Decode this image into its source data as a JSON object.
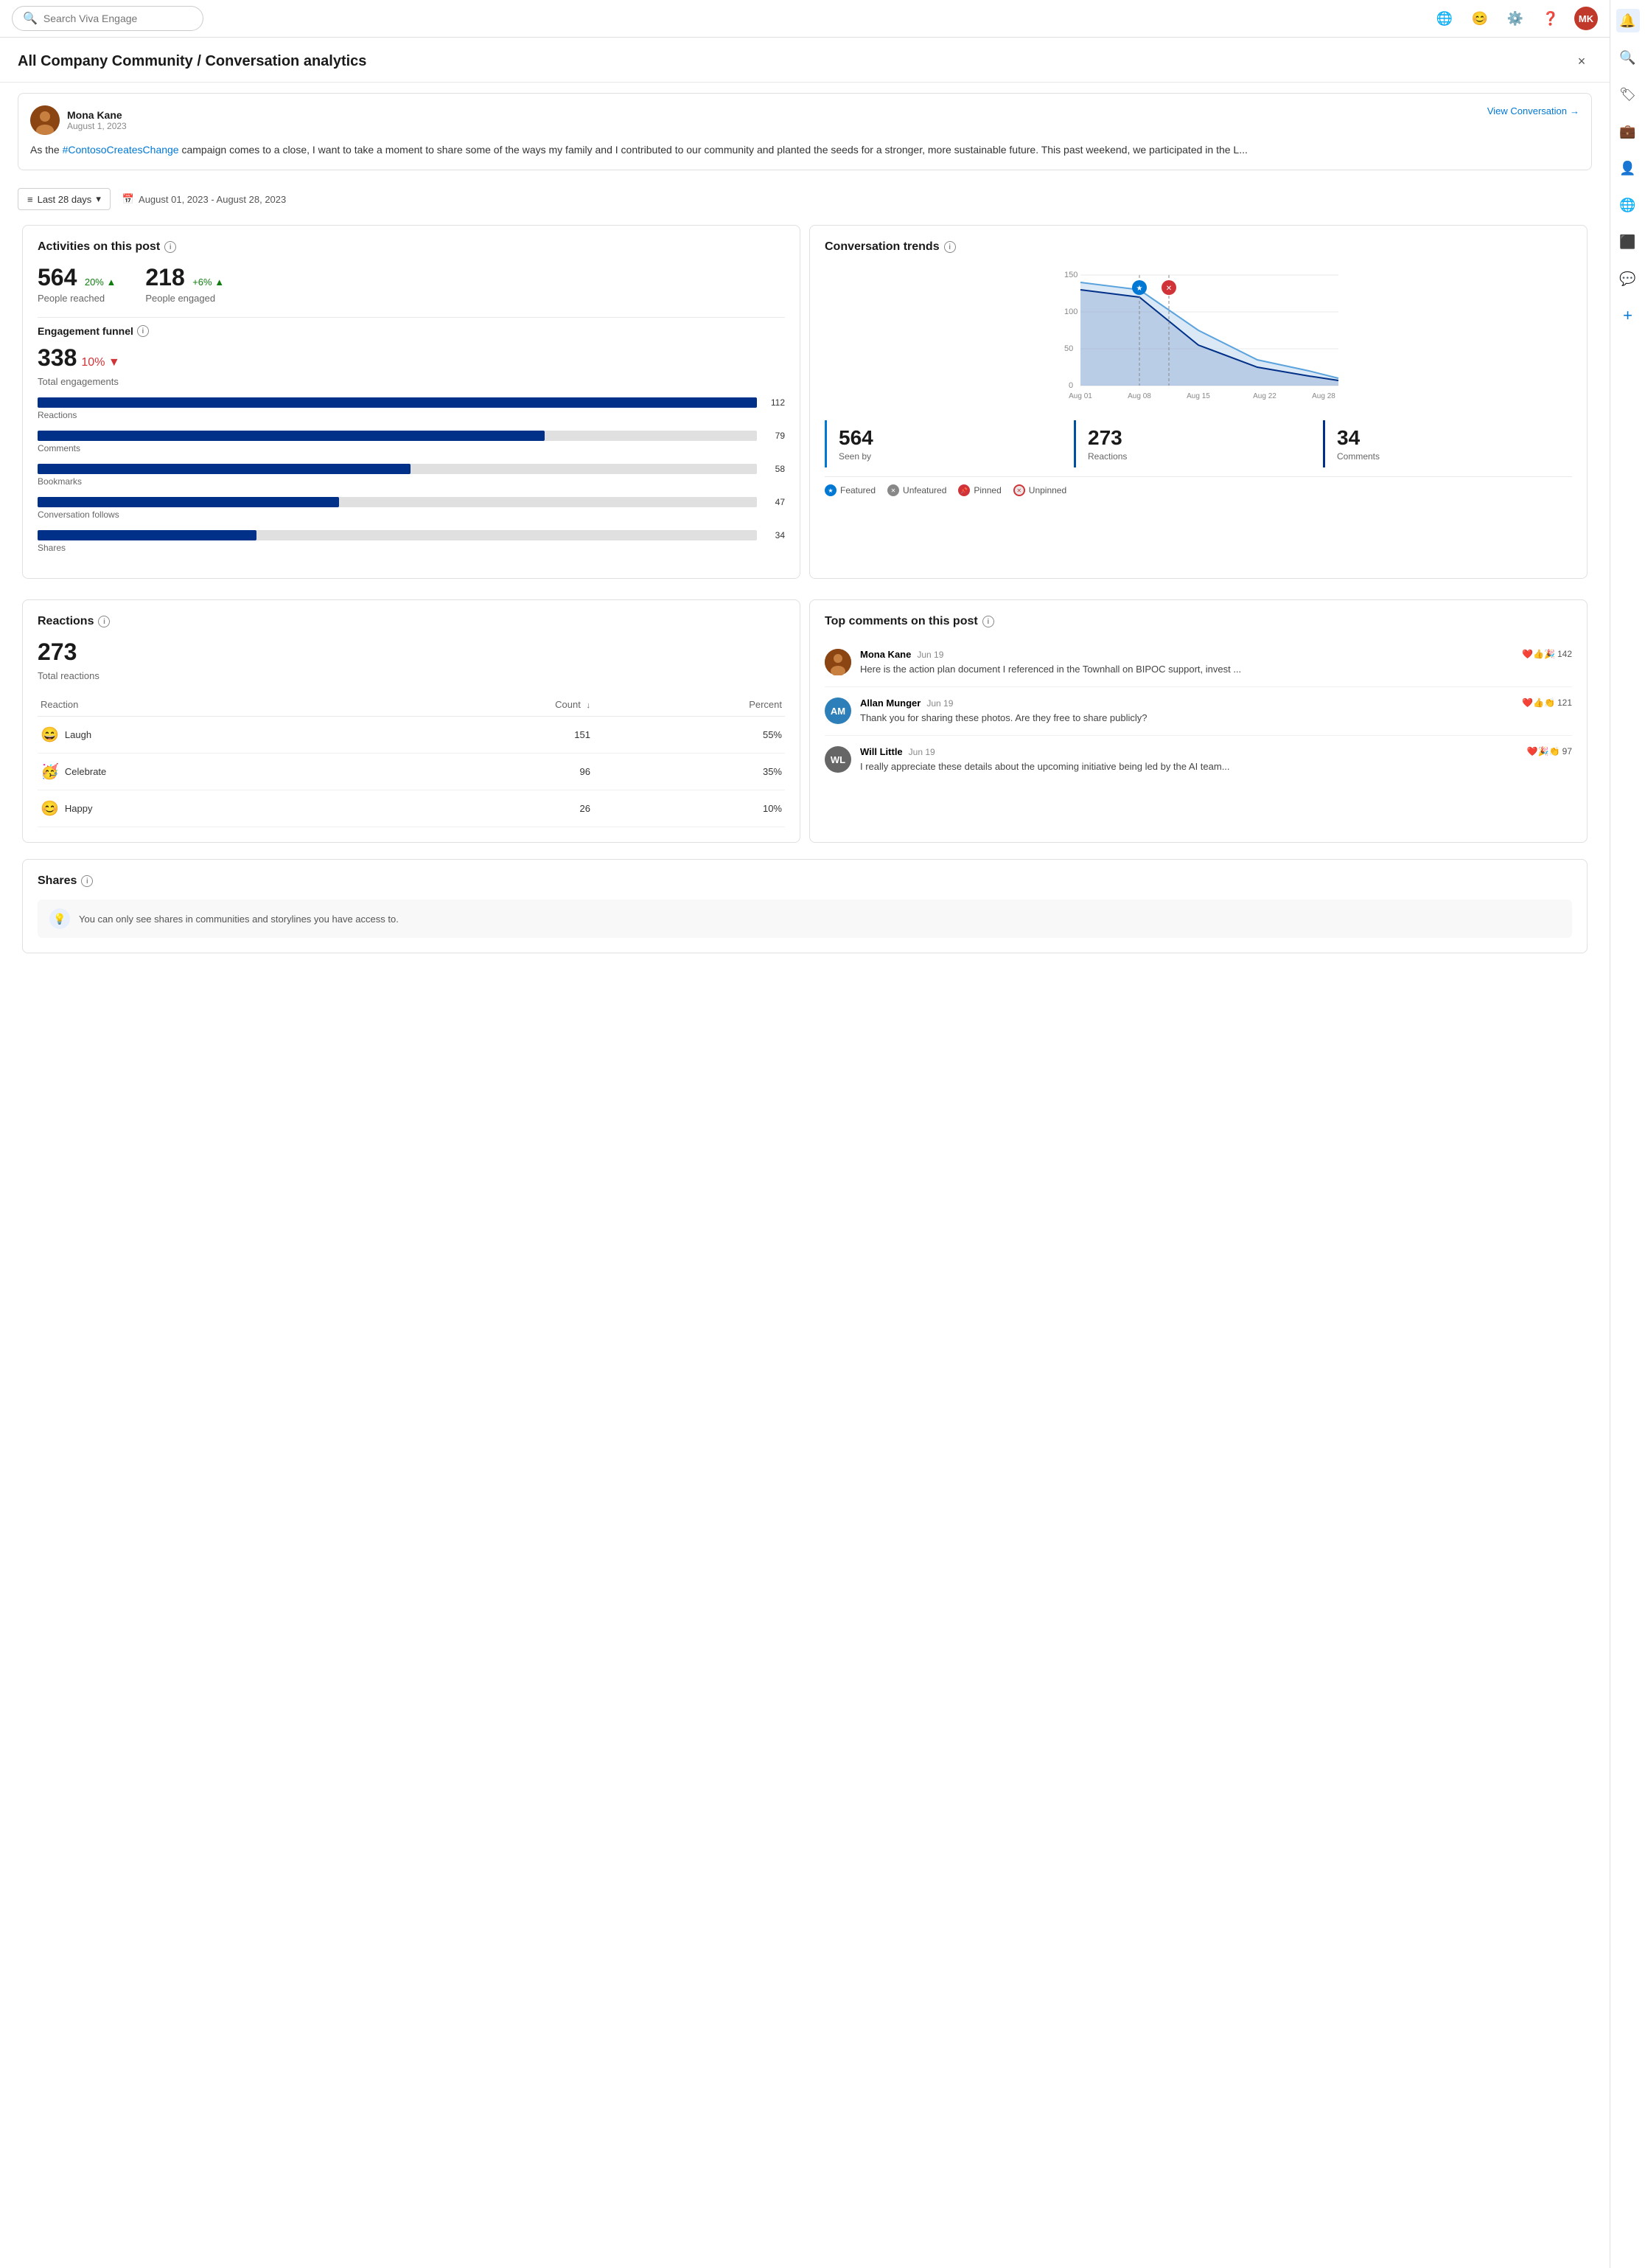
{
  "topbar": {
    "search_placeholder": "Search Viva Engage"
  },
  "panel": {
    "breadcrumb": "All Company Community / Conversation analytics",
    "title": "All Company Community / Conversation analytics",
    "close_label": "×"
  },
  "post": {
    "author_name": "Mona Kane",
    "author_date": "August 1, 2023",
    "author_initials": "MK",
    "text_prefix": "As the ",
    "hashtag": "#ContosoCreatesChange",
    "text_suffix": " campaign comes to a close, I want to take a moment to share some of the ways my family and I contributed to our community and planted the seeds for a stronger, more sustainable future. This past weekend, we participated in the L...",
    "view_conversation_label": "View Conversation"
  },
  "date_filter": {
    "period_label": "Last 28 days",
    "date_range": "August 01, 2023 - August 28, 2023"
  },
  "activities": {
    "section_title": "Activities on this post",
    "people_reached": "564",
    "people_reached_change": "20%",
    "people_reached_change_direction": "up",
    "people_reached_label": "People reached",
    "people_engaged": "218",
    "people_engaged_change": "+6%",
    "people_engaged_change_direction": "up",
    "people_engaged_label": "People engaged",
    "engagement_funnel_title": "Engagement funnel",
    "total_engagements": "338",
    "total_engagements_change": "10%",
    "total_engagements_change_direction": "down",
    "total_engagements_label": "Total engagements",
    "bars": [
      {
        "label": "Reactions",
        "value": 112,
        "max": 112
      },
      {
        "label": "Comments",
        "value": 79,
        "max": 112
      },
      {
        "label": "Bookmarks",
        "value": 58,
        "max": 112
      },
      {
        "label": "Conversation follows",
        "value": 47,
        "max": 112
      },
      {
        "label": "Shares",
        "value": 34,
        "max": 112
      }
    ]
  },
  "conversation_trends": {
    "section_title": "Conversation trends",
    "x_labels": [
      "Aug 01",
      "Aug 08",
      "Aug 15",
      "Aug 22",
      "Aug 28"
    ],
    "y_labels": [
      "0",
      "50",
      "100",
      "150"
    ],
    "stats": [
      {
        "value": "564",
        "label": "Seen by"
      },
      {
        "value": "273",
        "label": "Reactions"
      },
      {
        "value": "34",
        "label": "Comments"
      }
    ],
    "legend": [
      {
        "key": "featured",
        "label": "Featured"
      },
      {
        "key": "unfeatured",
        "label": "Unfeatured"
      },
      {
        "key": "pinned",
        "label": "Pinned"
      },
      {
        "key": "unpinned",
        "label": "Unpinned"
      }
    ]
  },
  "reactions": {
    "section_title": "Reactions",
    "total_reactions": "273",
    "total_label": "Total reactions",
    "col_reaction": "Reaction",
    "col_count": "Count",
    "col_percent": "Percent",
    "items": [
      {
        "emoji": "😄",
        "name": "Laugh",
        "count": "151",
        "percent": "55%"
      },
      {
        "emoji": "🥳",
        "name": "Celebrate",
        "count": "96",
        "percent": "35%"
      },
      {
        "emoji": "😊",
        "name": "Happy",
        "count": "26",
        "percent": "10%"
      }
    ]
  },
  "top_comments": {
    "section_title": "Top comments on this post",
    "comments": [
      {
        "author": "Mona Kane",
        "date": "Jun 19",
        "text": "Here is the action plan document I referenced in the Townhall on BIPOC support, invest ...",
        "reactions": "❤️👍🎉",
        "reaction_count": "142",
        "initials": "MK",
        "avatar_bg": "#8B4513"
      },
      {
        "author": "Allan Munger",
        "date": "Jun 19",
        "text": "Thank you for sharing these photos. Are they free to share publicly?",
        "reactions": "❤️👍👏",
        "reaction_count": "121",
        "initials": "AM",
        "avatar_bg": "#2c7fb8"
      },
      {
        "author": "Will Little",
        "date": "Jun 19",
        "text": "I really appreciate these details about the upcoming initiative being led by the AI team...",
        "reactions": "❤️🎉👏",
        "reaction_count": "97",
        "initials": "WL",
        "avatar_bg": "#555"
      }
    ]
  },
  "shares": {
    "section_title": "Shares",
    "note": "You can only see shares in communities and storylines you have access to."
  },
  "sidebar_icons": [
    {
      "name": "notification-icon",
      "symbol": "🔔",
      "active": true
    },
    {
      "name": "search-icon",
      "symbol": "🔍",
      "active": false
    },
    {
      "name": "bookmark-icon",
      "symbol": "🏷",
      "active": false
    },
    {
      "name": "briefcase-icon",
      "symbol": "💼",
      "active": false
    },
    {
      "name": "person-icon",
      "symbol": "👤",
      "active": false
    },
    {
      "name": "globe-icon",
      "symbol": "🌐",
      "active": false
    },
    {
      "name": "outlook-icon",
      "symbol": "📧",
      "active": false
    },
    {
      "name": "chat-icon",
      "symbol": "💬",
      "active": false
    },
    {
      "name": "add-icon",
      "symbol": "+",
      "active": false
    }
  ],
  "colors": {
    "accent": "#0078d4",
    "bar_fill": "#003087",
    "up_color": "#107c10",
    "down_color": "#d13438"
  }
}
